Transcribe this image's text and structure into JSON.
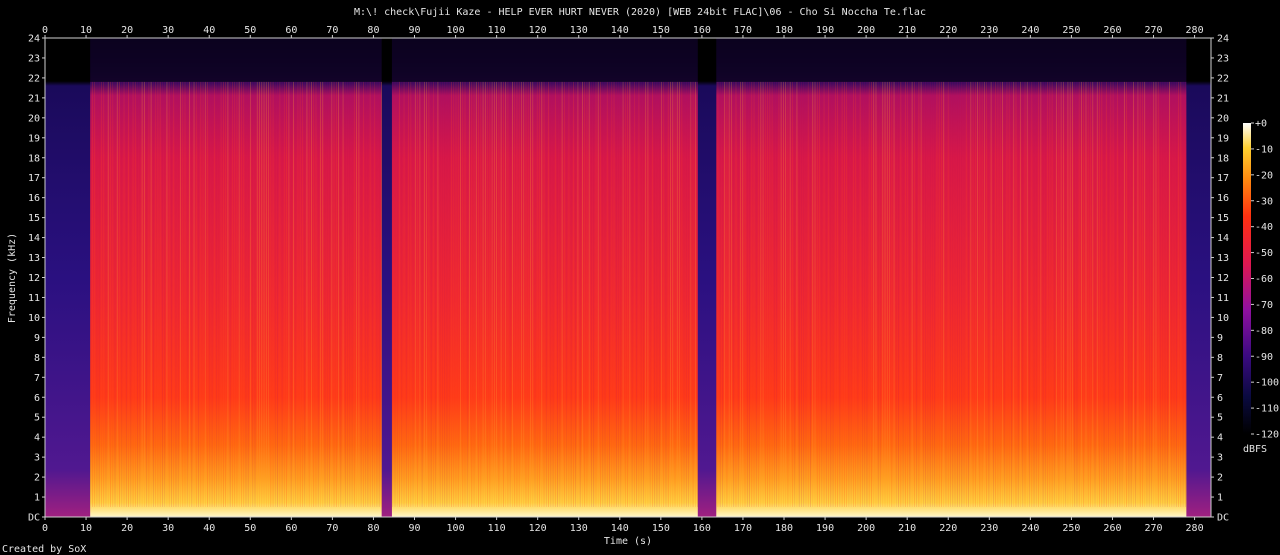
{
  "chart_data": {
    "type": "heatmap",
    "title": "M:\\! check\\Fujii Kaze - HELP EVER HURT NEVER (2020) [WEB 24bit FLAC]\\06 - Cho Si Noccha Te.flac",
    "xlabel": "Time (s)",
    "ylabel": "Frequency (kHz)",
    "xlim": [
      0,
      284
    ],
    "ylim": [
      0,
      24
    ],
    "x_ticks": [
      0,
      10,
      20,
      30,
      40,
      50,
      60,
      70,
      80,
      90,
      100,
      110,
      120,
      130,
      140,
      150,
      160,
      170,
      180,
      190,
      200,
      210,
      220,
      230,
      240,
      250,
      260,
      270,
      280
    ],
    "y_ticks": [
      "DC",
      "1",
      "2",
      "3",
      "4",
      "5",
      "6",
      "7",
      "8",
      "9",
      "10",
      "11",
      "12",
      "13",
      "14",
      "15",
      "16",
      "17",
      "18",
      "19",
      "20",
      "21",
      "22",
      "23",
      "24"
    ],
    "frequency_cutoff_khz": 21.8,
    "colorbar": {
      "label": "dBFS",
      "range": [
        -120,
        0
      ],
      "ticks": [
        "+0",
        "-10",
        "-20",
        "-30",
        "-40",
        "-50",
        "-60",
        "-70",
        "-80",
        "-90",
        "-100",
        "-110",
        "-120"
      ]
    },
    "quiet_segments_s": [
      [
        0,
        11
      ],
      [
        82,
        84.5
      ],
      [
        159,
        163.5
      ],
      [
        278,
        284
      ]
    ],
    "footer": "Created by SoX"
  },
  "colors": {
    "background": "#000000",
    "text": "#e6e6e6",
    "high": "#fff8a0",
    "mid": "#ff2a10",
    "low": "#1a0a5a"
  }
}
